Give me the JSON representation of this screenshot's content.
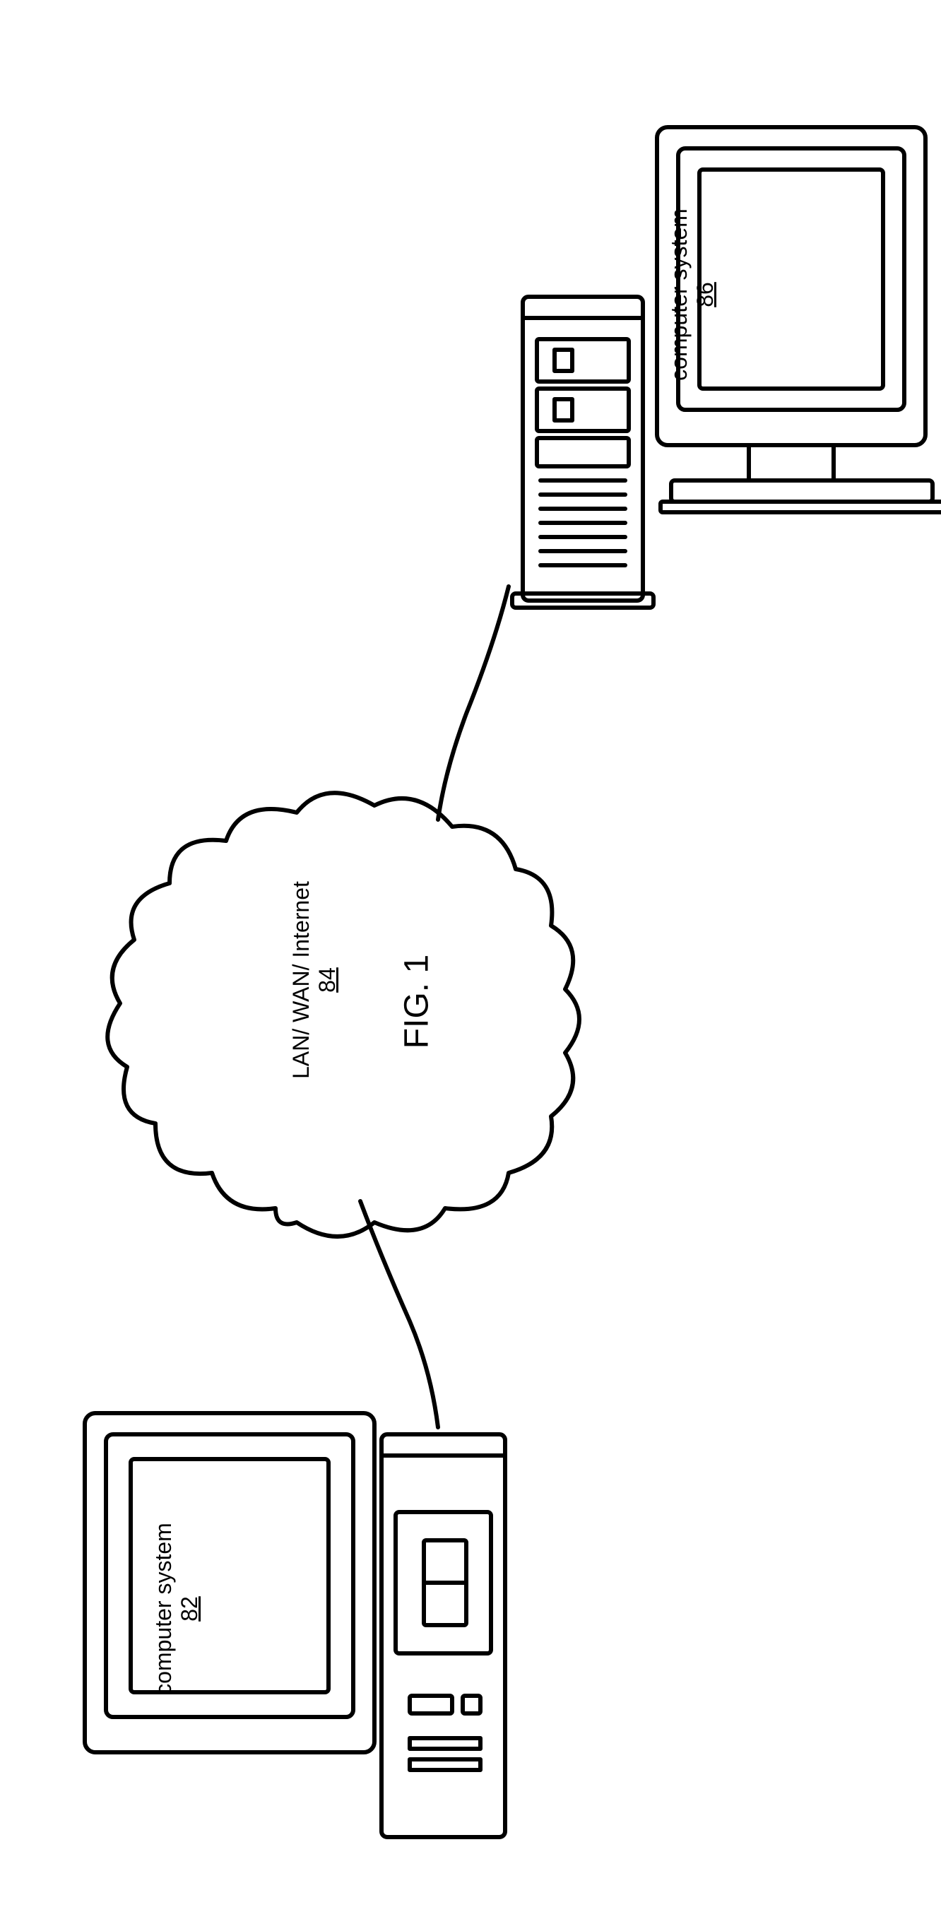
{
  "figure_label": "FIG. 1",
  "computer1": {
    "label": "computer system",
    "number": "82"
  },
  "network": {
    "label": "LAN/ WAN/ Internet",
    "number": "84"
  },
  "computer2": {
    "label": "computer system",
    "number": "86"
  }
}
